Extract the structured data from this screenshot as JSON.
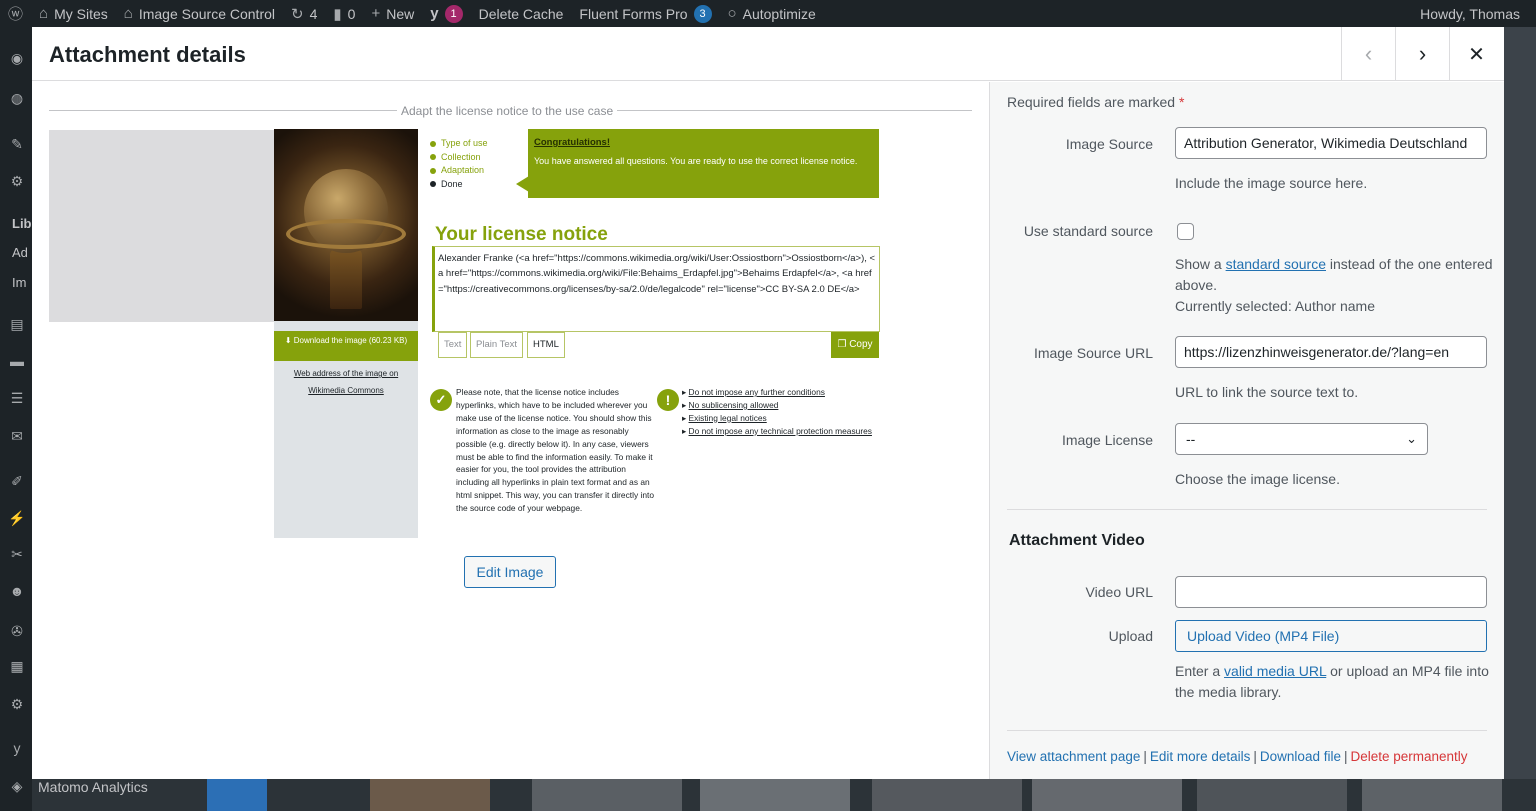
{
  "admin_bar": {
    "my_sites": "My Sites",
    "site_name": "Image Source Control",
    "updates_count": "4",
    "comments_count": "0",
    "new_label": "New",
    "yoast_count": "1",
    "delete_cache": "Delete Cache",
    "fluent_forms": "Fluent Forms Pro",
    "fluent_count": "3",
    "autoptimize": "Autoptimize",
    "howdy": "Howdy, Thomas"
  },
  "admin_menu": {
    "partial_label_1": "Lib",
    "partial_label_2": "Ad",
    "partial_label_3": "Im",
    "footer_item": "Matomo Analytics"
  },
  "modal": {
    "title": "Attachment details",
    "prev_icon": "‹",
    "next_icon": "›",
    "close_icon": "✕"
  },
  "embed": {
    "caption": "Adapt the license notice to the use case",
    "download_label": "Download the image (60.23 KB)",
    "wiki_link_1": "Web address of the image on",
    "wiki_link_2": "Wikimedia Commons",
    "steps": [
      {
        "label": "Type of use",
        "done": true
      },
      {
        "label": "Collection",
        "done": true
      },
      {
        "label": "Adaptation",
        "done": true
      },
      {
        "label": "Done",
        "done": false
      }
    ],
    "congrats_title": "Congratulations!",
    "congrats_text": "You have answered all questions. You are ready to use the correct license notice.",
    "license_title": "Your license notice",
    "license_text": "Alexander Franke (<a href=\"https://commons.wikimedia.org/wiki/User:Ossiostborn\">Ossiostborn</a>), <a href=\"https://commons.wikimedia.org/wiki/File:Behaims_Erdapfel.jpg\">Behaims Erdapfel</a>, <a href=\"https://creativecommons.org/licenses/by-sa/2.0/de/legalcode\" rel=\"license\">CC BY-SA 2.0 DE</a>",
    "tabs": [
      "Text",
      "Plain Text",
      "HTML"
    ],
    "copy_label": "Copy",
    "note_text": "Please note, that the license notice includes hyperlinks, which have to be included wherever you make use of the license notice. You should show this information as close to the image as resonably possible (e.g. directly below it). In any case, viewers must be able to find the information easily. To make it easier for you, the tool provides the attribution including all hyperlinks in plain text format and as an html snippet. This way, you can transfer it directly into the source code of your webpage.",
    "conditions": [
      "Do not impose any further conditions",
      "No sublicensing allowed",
      "Existing legal notices",
      "Do not impose any technical protection measures"
    ],
    "edit_image": "Edit Image"
  },
  "details": {
    "required_note": "Required fields are marked",
    "required_star": "*",
    "image_source_label": "Image Source",
    "image_source_value": "Attribution Generator, Wikimedia Deutschland",
    "image_source_help": "Include the image source here.",
    "standard_source_label": "Use standard source",
    "standard_help_pre": "Show a ",
    "standard_help_link": "standard source",
    "standard_help_post": " instead of the one entered above.",
    "currently_selected": "Currently selected: Author name",
    "source_url_label": "Image Source URL",
    "source_url_value": "https://lizenzhinweisgenerator.de/?lang=en",
    "source_url_help": "URL to link the source text to.",
    "license_label": "Image License",
    "license_value": "--",
    "license_help": "Choose the image license.",
    "video_heading": "Attachment Video",
    "video_url_label": "Video URL",
    "video_url_value": "",
    "upload_label": "Upload",
    "upload_button": "Upload Video (MP4 File)",
    "video_help_pre": "Enter a ",
    "video_help_link": "valid media URL",
    "video_help_post": " or upload an MP4 file into the media library.",
    "actions": {
      "view": "View attachment page",
      "edit": "Edit more details",
      "download": "Download file",
      "delete": "Delete permanently"
    }
  },
  "colors": {
    "accent": "#86a20c",
    "wp_blue": "#2271b1",
    "danger": "#d63638",
    "admin_bar": "#1d2327"
  }
}
